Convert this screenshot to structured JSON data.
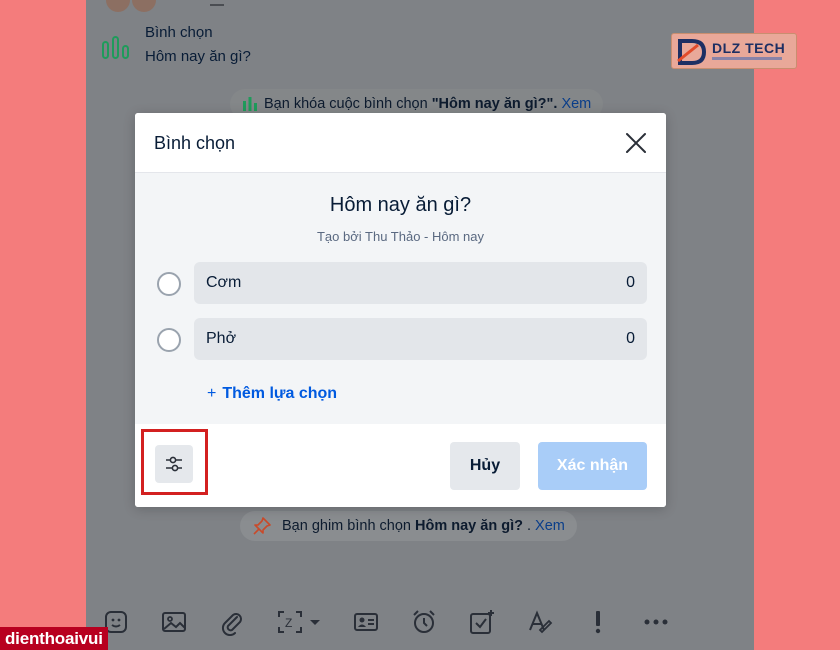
{
  "chat": {
    "poll_message_title": "Bình chọn",
    "poll_message_question": "Hôm nay ăn gì?",
    "lock_notice_prefix": "Bạn khóa cuộc bình chọn",
    "lock_notice_bold": "\"Hôm nay ăn gì?\".",
    "lock_notice_link": "Xem",
    "pin_notice_prefix": "Bạn ghim bình chọn",
    "pin_notice_bold": "Hôm nay ăn gì?",
    "pin_notice_dot": ".",
    "pin_notice_link": "Xem"
  },
  "modal": {
    "title": "Bình chọn",
    "question": "Hôm nay ăn gì?",
    "meta": "Tạo bởi Thu Thảo - Hôm nay",
    "options": [
      {
        "label": "Cơm",
        "count": "0"
      },
      {
        "label": "Phở",
        "count": "0"
      }
    ],
    "add_option_label": "Thêm lựa chọn",
    "cancel_label": "Hủy",
    "confirm_label": "Xác nhận"
  },
  "logo": {
    "brand": "DLZ TECH"
  },
  "watermark": "dienthoaivui",
  "colors": {
    "accent": "#005ae0",
    "confirm_disabled": "#a9cdf8",
    "highlight": "#d32020",
    "page_background": "#f47c7c",
    "chart_icon": "#1f9b5b"
  },
  "toolbar_icons": [
    "sticker-icon",
    "image-icon",
    "attachment-icon",
    "screenshot-icon",
    "contact-card-icon",
    "reminder-icon",
    "task-icon",
    "text-format-icon",
    "urgent-icon",
    "more-icon"
  ]
}
